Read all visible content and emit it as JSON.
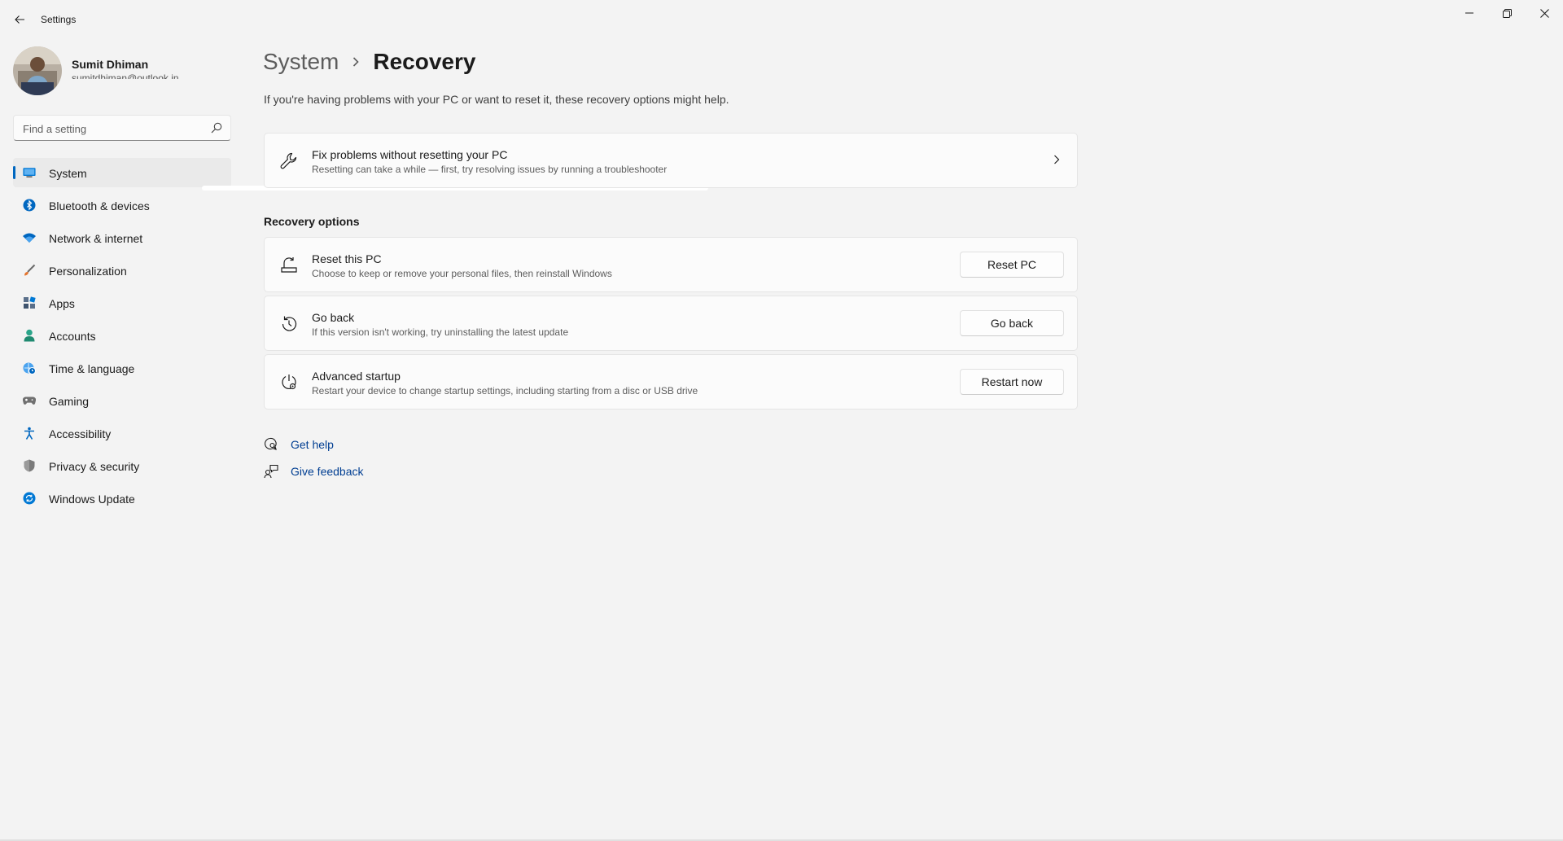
{
  "window": {
    "title": "Settings",
    "minimize_glyph": "—",
    "close_glyph": "✕"
  },
  "profile": {
    "name": "Sumit Dhiman",
    "email": "sumitdhiman@outlook.in"
  },
  "search": {
    "placeholder": "Find a setting"
  },
  "sidebar": {
    "items": [
      {
        "label": "System",
        "icon": "system-icon",
        "active": true
      },
      {
        "label": "Bluetooth & devices",
        "icon": "bluetooth-icon"
      },
      {
        "label": "Network & internet",
        "icon": "wifi-icon"
      },
      {
        "label": "Personalization",
        "icon": "brush-icon"
      },
      {
        "label": "Apps",
        "icon": "apps-icon"
      },
      {
        "label": "Accounts",
        "icon": "person-icon"
      },
      {
        "label": "Time & language",
        "icon": "globe-clock-icon"
      },
      {
        "label": "Gaming",
        "icon": "gamepad-icon"
      },
      {
        "label": "Accessibility",
        "icon": "accessibility-icon"
      },
      {
        "label": "Privacy & security",
        "icon": "shield-icon"
      },
      {
        "label": "Windows Update",
        "icon": "update-icon"
      }
    ]
  },
  "breadcrumb": {
    "parent": "System",
    "current": "Recovery"
  },
  "main": {
    "intro": "If you're having problems with your PC or want to reset it, these recovery options might help.",
    "fix_card": {
      "title": "Fix problems without resetting your PC",
      "desc": "Resetting can take a while — first, try resolving issues by running a troubleshooter"
    },
    "section_title": "Recovery options",
    "options": [
      {
        "title": "Reset this PC",
        "desc": "Choose to keep or remove your personal files, then reinstall Windows",
        "button": "Reset PC",
        "icon": "reset-pc-icon"
      },
      {
        "title": "Go back",
        "desc": "If this version isn't working, try uninstalling the latest update",
        "button": "Go back",
        "icon": "history-icon"
      },
      {
        "title": "Advanced startup",
        "desc": "Restart your device to change startup settings, including starting from a disc or USB drive",
        "button": "Restart now",
        "icon": "advanced-startup-icon"
      }
    ],
    "links": [
      {
        "label": "Get help",
        "icon": "get-help-icon"
      },
      {
        "label": "Give feedback",
        "icon": "feedback-icon"
      }
    ]
  },
  "colors": {
    "accent": "#0067c0",
    "link": "#003e92",
    "background": "#f3f3f3",
    "card": "#fbfbfb"
  }
}
